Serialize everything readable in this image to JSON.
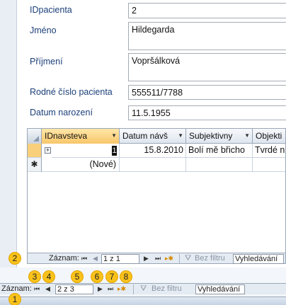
{
  "form": {
    "fields": [
      {
        "label": "IDpacienta",
        "value": "2"
      },
      {
        "label": "Jméno",
        "value": "Hildegarda"
      },
      {
        "label": "Příjmení",
        "value": "Vopršálková"
      },
      {
        "label": "Rodné číslo pacienta",
        "value": "555511/7788"
      },
      {
        "label": "Datum narození",
        "value": "11.5.1955"
      }
    ]
  },
  "subform": {
    "columns": [
      "IDnavsteva",
      "Datum návš",
      "Subjektivny",
      "Objekti"
    ],
    "row": {
      "id": "1",
      "datum": "15.8.2010",
      "subjektivny": "Bolí mě břicho",
      "objektivny": "Tvrdé n"
    },
    "new_row_label": "(Nové)",
    "new_row_marker": "✱",
    "expand_marker": "+",
    "nav": {
      "label": "Záznam:",
      "counter": "1 z 1",
      "filter": "Bez filtru",
      "search": "Vyhledávání"
    }
  },
  "main_nav": {
    "label": "Záznam:",
    "counter": "2 z 3",
    "filter": "Bez filtru",
    "search": "Vyhledávání"
  },
  "nav_glyphs": {
    "first": "⏮",
    "prev": "◀",
    "next": "▶",
    "last": "⏭",
    "new": "▸✱",
    "filter_icon": "⛛"
  },
  "callouts": [
    "1",
    "2",
    "3",
    "4",
    "5",
    "6",
    "7",
    "8"
  ],
  "colors": {
    "accent_label": "#1b3f78",
    "callout": "#f9c21a",
    "active_header": "#f8c66a"
  }
}
